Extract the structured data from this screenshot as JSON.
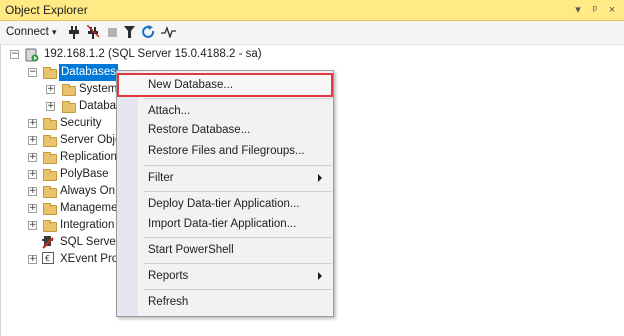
{
  "window": {
    "title": "Object Explorer",
    "controls": [
      "▾",
      "ᵖ",
      "×"
    ]
  },
  "toolbar": {
    "connect_label": "Connect",
    "connect_arrow": "▾"
  },
  "tree": {
    "server": "192.168.1.2 (SQL Server 15.0.4188.2 - sa)",
    "databases": "Databases",
    "system": "System",
    "databas": "Databas",
    "security": "Security",
    "server_obj": "Server Obje",
    "replication": "Replication",
    "polybase": "PolyBase",
    "always_on": "Always On",
    "management": "Manageme",
    "integration": "Integration",
    "sql_server": "SQL Server",
    "xevent": "XEvent Prof"
  },
  "context_menu": {
    "new_database": "New Database...",
    "attach": "Attach...",
    "restore_database": "Restore Database...",
    "restore_files": "Restore Files and Filegroups...",
    "filter": "Filter",
    "deploy": "Deploy Data-tier Application...",
    "import": "Import Data-tier Application...",
    "powershell": "Start PowerShell",
    "reports": "Reports",
    "refresh": "Refresh"
  },
  "colors": {
    "title_bar": "#ffea85",
    "selection": "#0078d7",
    "highlight_border": "#e0383e"
  }
}
